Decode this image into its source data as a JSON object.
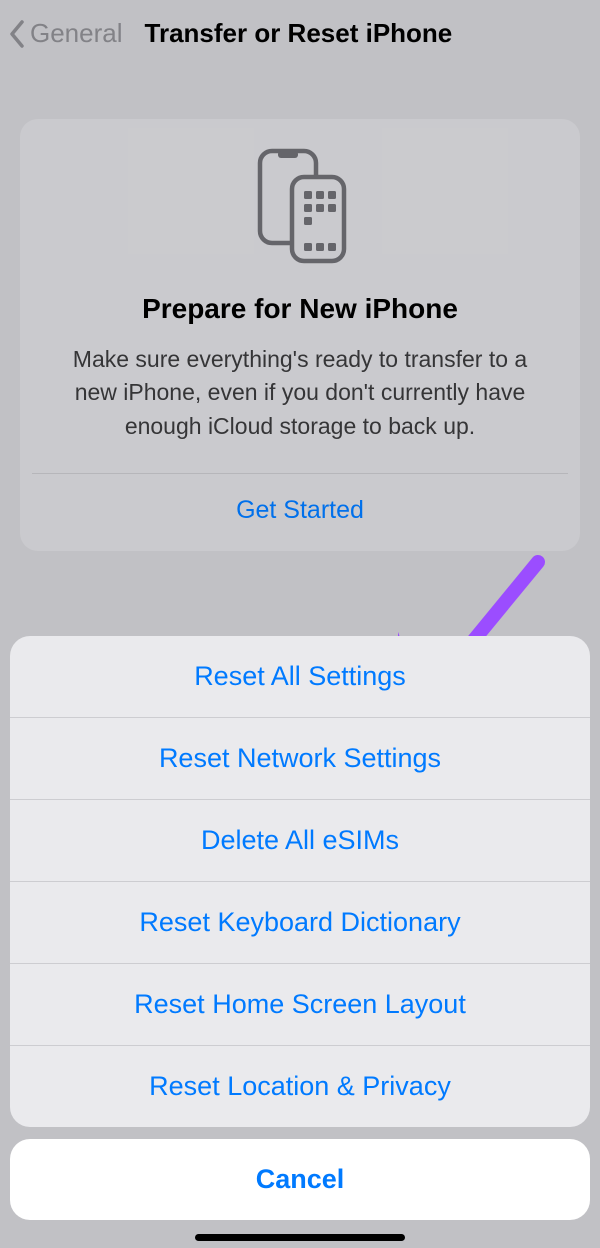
{
  "nav": {
    "back_label": "General",
    "title": "Transfer or Reset iPhone"
  },
  "card": {
    "title": "Prepare for New iPhone",
    "description": "Make sure everything's ready to transfer to a new iPhone, even if you don't currently have enough iCloud storage to back up.",
    "action": "Get Started"
  },
  "sheet": {
    "items": [
      "Reset All Settings",
      "Reset Network Settings",
      "Delete All eSIMs",
      "Reset Keyboard Dictionary",
      "Reset Home Screen Layout",
      "Reset Location & Privacy"
    ],
    "cancel": "Cancel"
  },
  "colors": {
    "link": "#007aff",
    "arrow": "#9b4dff"
  }
}
